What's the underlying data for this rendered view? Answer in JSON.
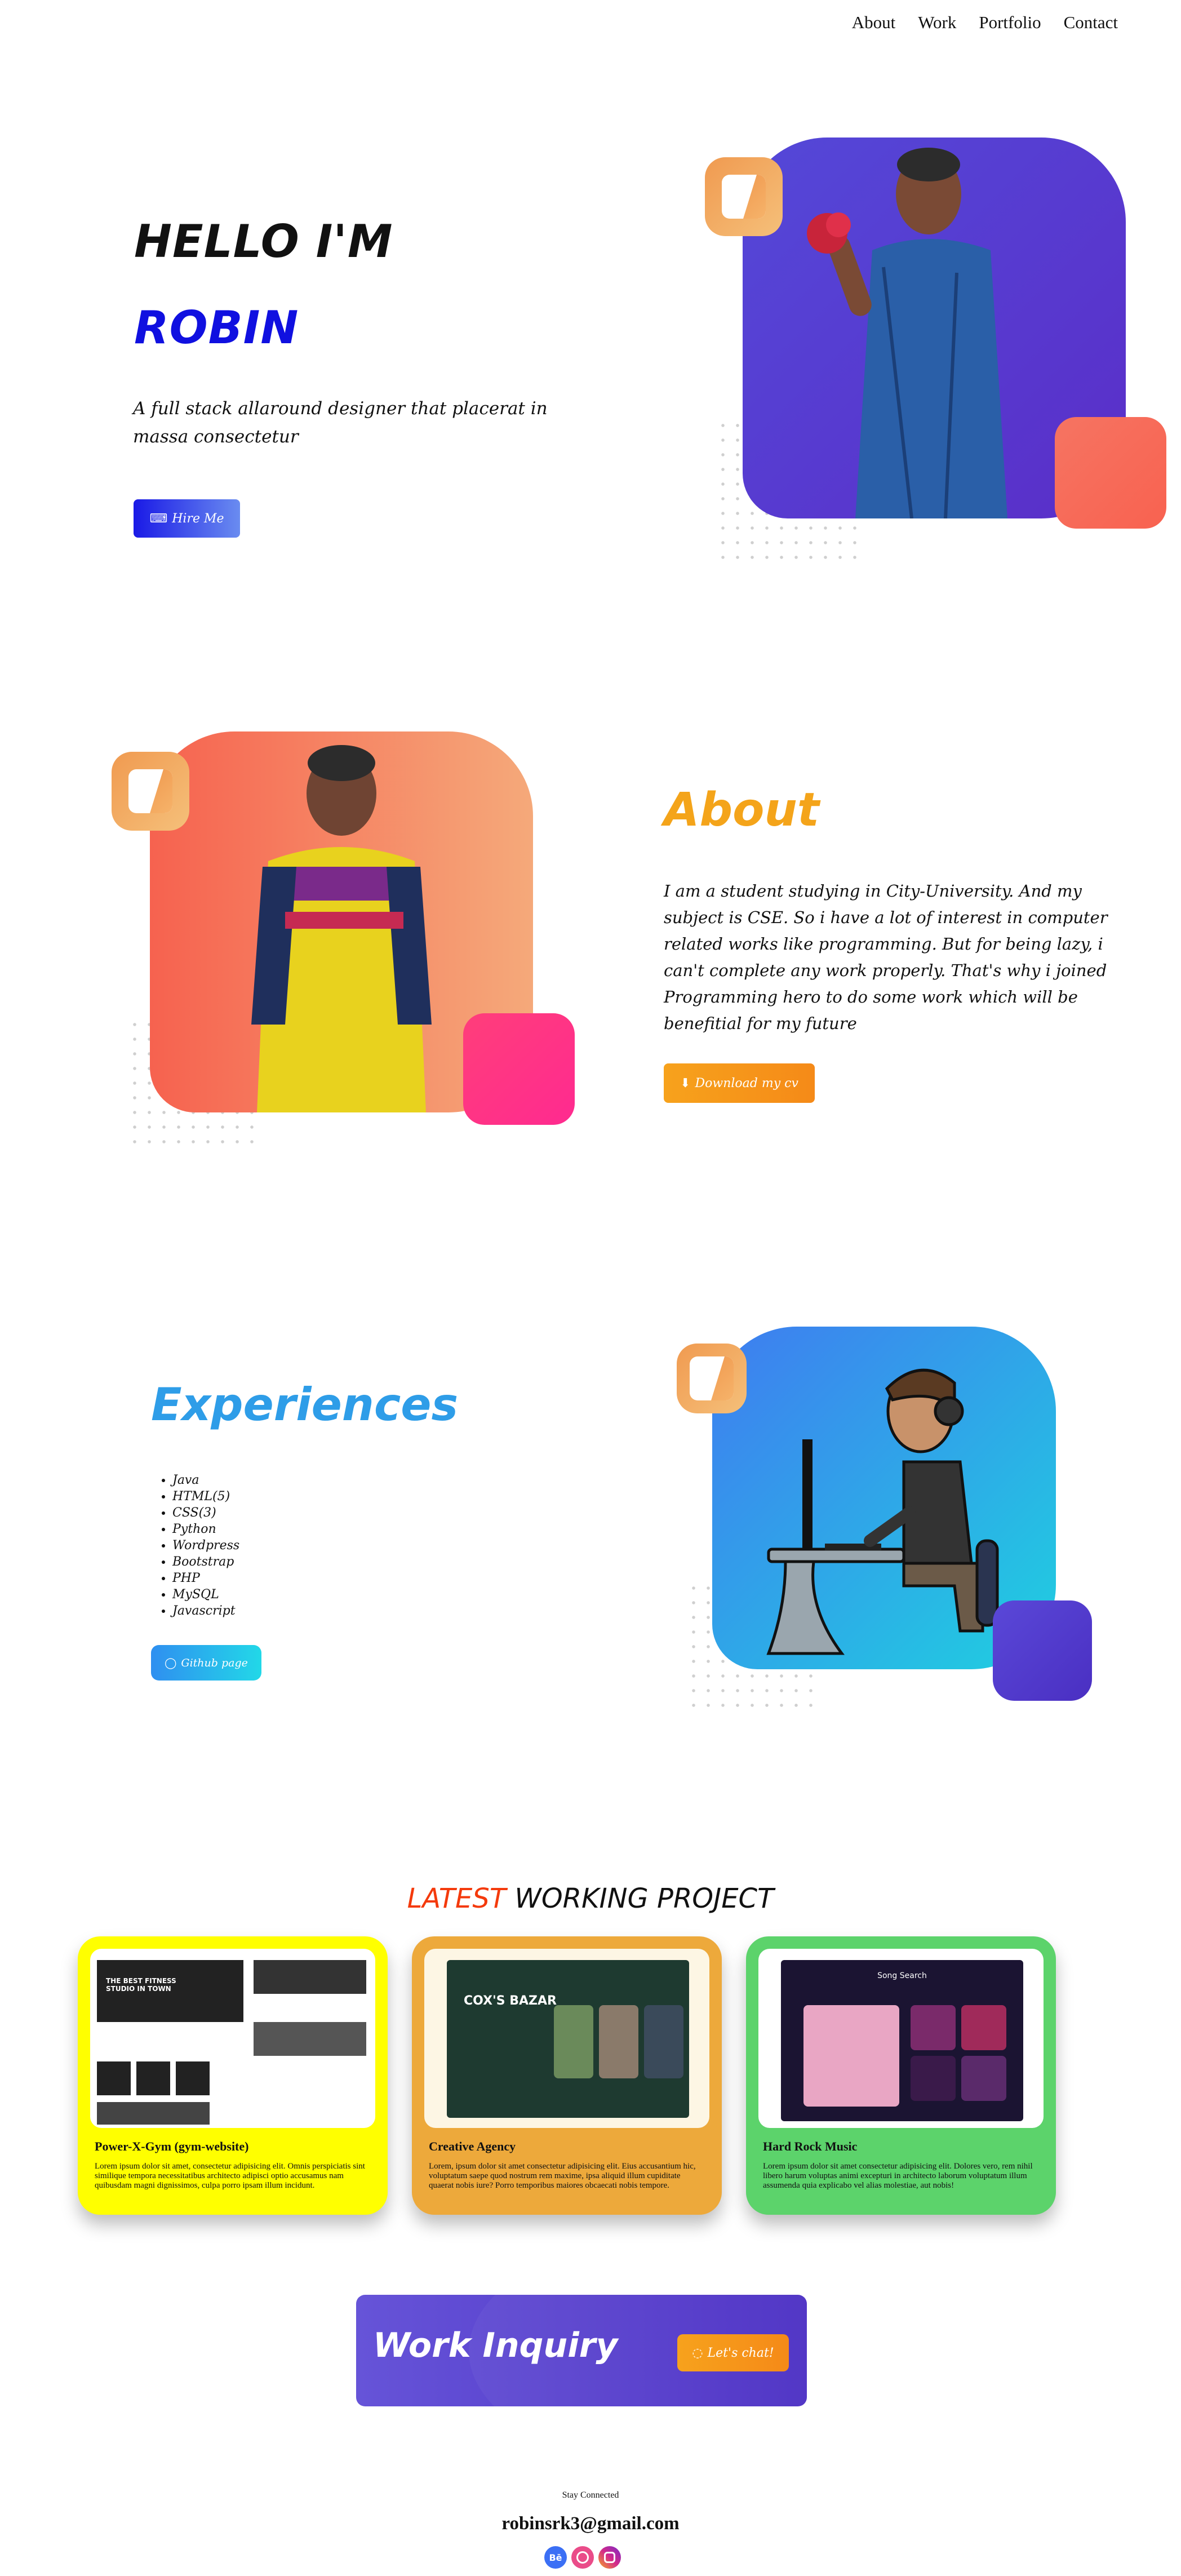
{
  "nav": {
    "items": [
      "About",
      "Work",
      "Portfolio",
      "Contact"
    ]
  },
  "hero": {
    "greeting": "HELLO I'M",
    "name": "ROBIN",
    "tagline": "A full stack allaround designer that placerat in massa consectetur",
    "hire_label": "Hire Me",
    "hire_icon": "keyboard-icon"
  },
  "about": {
    "title": "About",
    "text": "I am a student studying in City-University. And my subject is CSE. So i have a lot of interest in computer related works like programming. But for being lazy, i can't complete any work properly. That's why i joined Programming hero to do some work which will be benefitial for my future",
    "download_label": "Download my cv",
    "download_icon": "download-icon"
  },
  "experience": {
    "title": "Experiences",
    "skills": [
      "Java",
      "HTML(5)",
      "CSS(3)",
      "Python",
      "Wordpress",
      "Bootstrap",
      "PHP",
      "MySQL",
      "Javascript"
    ],
    "github_label": "Github page",
    "github_icon": "github-icon"
  },
  "projects": {
    "title_accent": "LATEST",
    "title_rest": "WORKING PROJECT",
    "accent_color": "#f43a0c",
    "items": [
      {
        "title": "Power-X-Gym (gym-website)",
        "desc": "Lorem ipsum dolor sit amet, consectetur adipisicing elit. Omnis perspiciatis sint similique tempora necessitatibus architecto adipisci optio accusamus nam quibusdam magni dignissimos, culpa porro ipsam illum incidunt.",
        "color": "#ffff00",
        "shot_heading": "THE BEST FITNESS STUDIO IN TOWN"
      },
      {
        "title": "Creative Agency",
        "desc": "Lorem, ipsum dolor sit amet consectetur adipisicing elit. Eius accusantium hic, voluptatum saepe quod nostrum rem maxime, ipsa aliquid illum cupiditate quaerat nobis iure? Porro temporibus maiores obcaecati nobis tempore.",
        "color": "#eda93b",
        "shot_heading": "COX'S BAZAR"
      },
      {
        "title": "Hard Rock Music",
        "desc": "Lorem ipsum dolor sit amet consectetur adipisicing elit. Dolores vero, rem nihil libero harum voluptas animi excepturi in architecto laborum voluptatum illum assumenda quia explicabo vel alias molestiae, aut nobis!",
        "color": "#5cd36b",
        "shot_heading": "Song Search"
      }
    ]
  },
  "inquiry": {
    "title": "Work Inquiry",
    "chat_label": "Let's chat!",
    "chat_icon": "chat-icon"
  },
  "footer": {
    "stay": "Stay Connected",
    "email": "robinsrk3@gmail.com",
    "social": [
      {
        "icon": "behance-icon",
        "glyph": "Bē",
        "color": "#3b6ff5"
      },
      {
        "icon": "dribbble-icon",
        "glyph": "",
        "color": "#ea4c89"
      },
      {
        "icon": "instagram-icon",
        "glyph": "",
        "color": "#d42a8a"
      }
    ]
  }
}
